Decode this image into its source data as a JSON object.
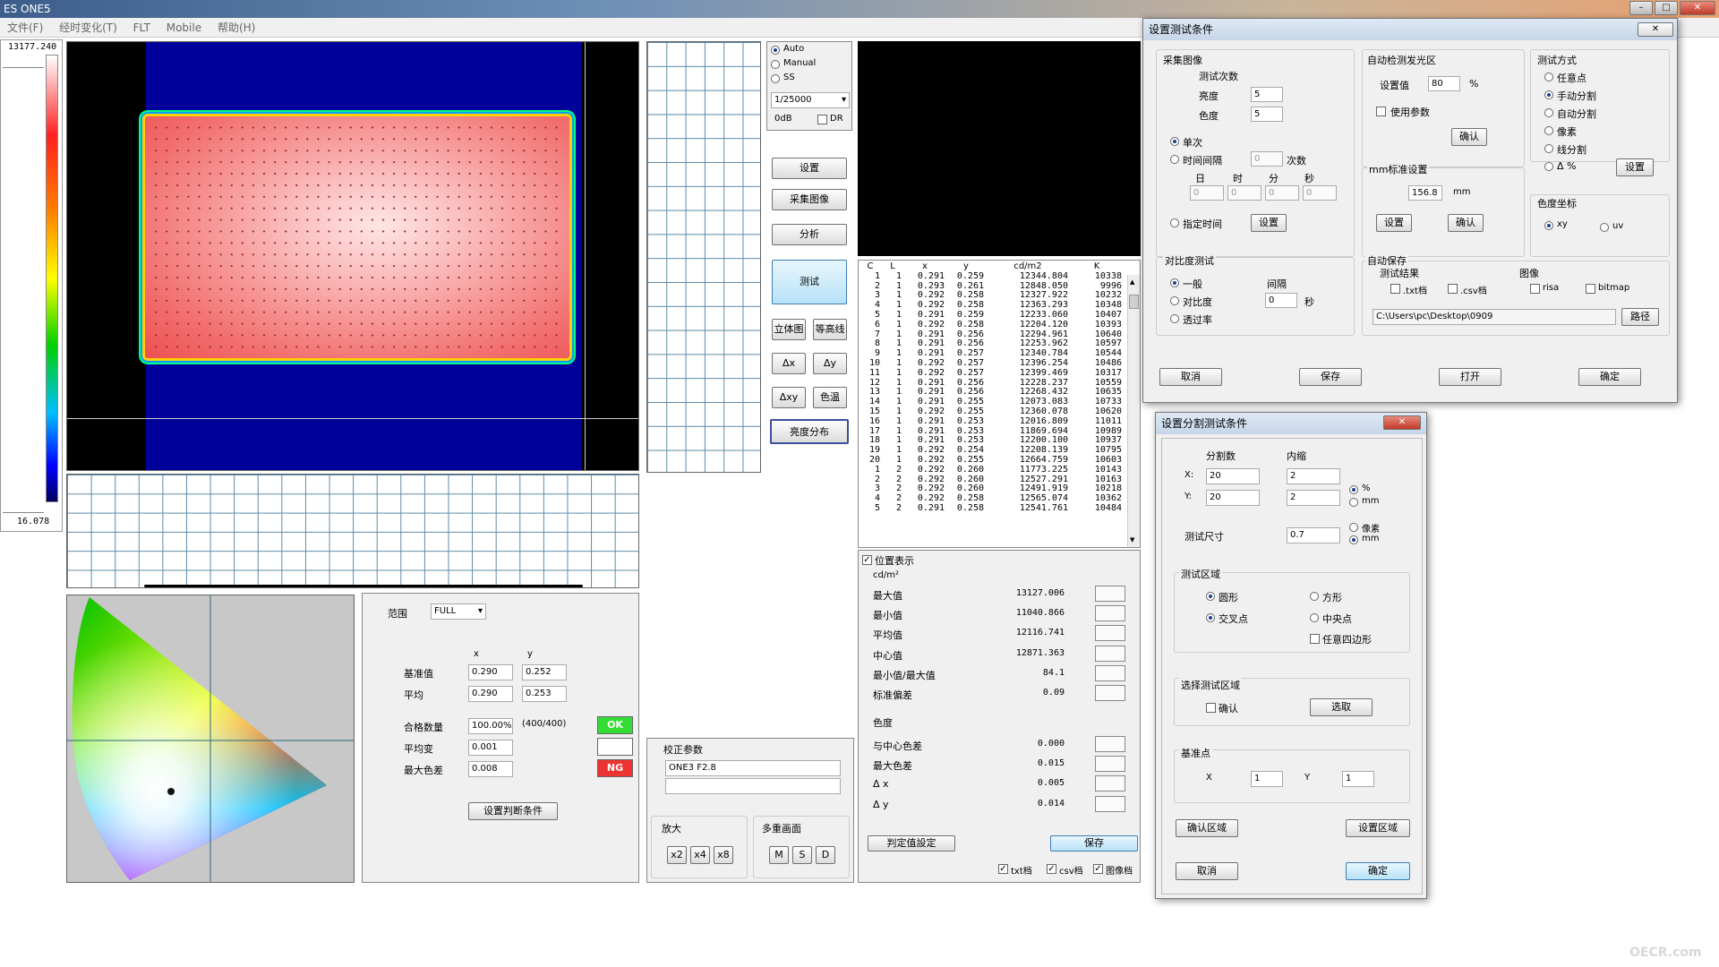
{
  "window": {
    "icon": "ES",
    "title": "ONE5",
    "min_label": "–",
    "max_label": "□",
    "close_label": "✕"
  },
  "menu": [
    "文件(F)",
    "经时变化(T)",
    "FLT",
    "Mobile",
    "帮助(H)"
  ],
  "scale": {
    "max": "13177.240",
    "min": "16.078"
  },
  "camera": {
    "mode_options": [
      "Auto",
      "Manual",
      "SS"
    ],
    "selected_mode": "Auto",
    "shutter": "1/25000",
    "gain": "0dB",
    "dr_label": "DR"
  },
  "side_buttons": {
    "settings": "设置",
    "capture": "采集图像",
    "analyze": "分析",
    "test": "测试",
    "stereo": "立体图",
    "contour": "等高线",
    "dx": "Δx",
    "dy": "Δy",
    "dxy": "Δxy",
    "color_temp": "色温",
    "brightness_dist": "亮度分布"
  },
  "table": {
    "headers": [
      "C",
      "L",
      "x",
      "y",
      "cd/m2",
      "K"
    ],
    "rows": [
      [
        "1",
        "1",
        "0.291",
        "0.259",
        "12344.804",
        "10338"
      ],
      [
        "2",
        "1",
        "0.293",
        "0.261",
        "12848.050",
        "9996"
      ],
      [
        "3",
        "1",
        "0.292",
        "0.258",
        "12327.922",
        "10232"
      ],
      [
        "4",
        "1",
        "0.292",
        "0.258",
        "12363.293",
        "10348"
      ],
      [
        "5",
        "1",
        "0.291",
        "0.259",
        "12233.060",
        "10407"
      ],
      [
        "6",
        "1",
        "0.292",
        "0.258",
        "12204.120",
        "10393"
      ],
      [
        "7",
        "1",
        "0.291",
        "0.256",
        "12294.961",
        "10640"
      ],
      [
        "8",
        "1",
        "0.291",
        "0.256",
        "12253.962",
        "10597"
      ],
      [
        "9",
        "1",
        "0.291",
        "0.257",
        "12340.784",
        "10544"
      ],
      [
        "10",
        "1",
        "0.292",
        "0.257",
        "12396.254",
        "10486"
      ],
      [
        "11",
        "1",
        "0.292",
        "0.257",
        "12399.469",
        "10317"
      ],
      [
        "12",
        "1",
        "0.291",
        "0.256",
        "12228.237",
        "10559"
      ],
      [
        "13",
        "1",
        "0.291",
        "0.256",
        "12268.432",
        "10635"
      ],
      [
        "14",
        "1",
        "0.291",
        "0.255",
        "12073.083",
        "10733"
      ],
      [
        "15",
        "1",
        "0.292",
        "0.255",
        "12360.078",
        "10620"
      ],
      [
        "16",
        "1",
        "0.291",
        "0.253",
        "12016.809",
        "11011"
      ],
      [
        "17",
        "1",
        "0.291",
        "0.253",
        "11869.694",
        "10989"
      ],
      [
        "18",
        "1",
        "0.291",
        "0.253",
        "12200.100",
        "10937"
      ],
      [
        "19",
        "1",
        "0.292",
        "0.254",
        "12208.139",
        "10795"
      ],
      [
        "20",
        "1",
        "0.292",
        "0.255",
        "12664.759",
        "10603"
      ],
      [
        "1",
        "2",
        "0.292",
        "0.260",
        "11773.225",
        "10143"
      ],
      [
        "2",
        "2",
        "0.292",
        "0.260",
        "12527.291",
        "10163"
      ],
      [
        "3",
        "2",
        "0.292",
        "0.260",
        "12491.919",
        "10218"
      ],
      [
        "4",
        "2",
        "0.292",
        "0.258",
        "12565.074",
        "10362"
      ],
      [
        "5",
        "2",
        "0.291",
        "0.258",
        "12541.761",
        "10484"
      ]
    ]
  },
  "position_display": "位置表示",
  "stats": {
    "unit": "cd/m²",
    "rows": [
      {
        "label": "最大值",
        "value": "13127.006"
      },
      {
        "label": "最小值",
        "value": "11040.866"
      },
      {
        "label": "平均值",
        "value": "12116.741"
      },
      {
        "label": "中心值",
        "value": "12871.363"
      },
      {
        "label": "最小值/最大值",
        "value": "84.1"
      },
      {
        "label": "标准偏差",
        "value": "0.09"
      }
    ],
    "chroma_title": "色度",
    "chroma_rows": [
      {
        "label": "与中心色差",
        "value": "0.000"
      },
      {
        "label": "最大色差",
        "value": "0.015"
      },
      {
        "label": "Δ x",
        "value": "0.005"
      },
      {
        "label": "Δ y",
        "value": "0.014"
      }
    ],
    "judge_btn": "判定值設定",
    "save_btn": "保存",
    "txt": "txt档",
    "csv": "csv档",
    "img": "图像档"
  },
  "analysis": {
    "range_label": "范围",
    "range_value": "FULL",
    "col_x": "x",
    "col_y": "y",
    "base_label": "基准值",
    "base_x": "0.290",
    "base_y": "0.252",
    "avg_label": "平均",
    "avg_x": "0.290",
    "avg_y": "0.253",
    "pass_label": "合格数量",
    "pass_value": "100.00%",
    "pass_count": "(400/400)",
    "ok": "OK",
    "avgvar_label": "平均变",
    "avgvar_value": "0.001",
    "maxdiff_label": "最大色差",
    "maxdiff_value": "0.008",
    "ng": "NG",
    "judge_btn": "设置判断条件"
  },
  "calib": {
    "title": "校正参数",
    "value": "ONE3 F2.8",
    "zoom_title": "放大",
    "zoom": [
      "x2",
      "x4",
      "x8"
    ],
    "multi_title": "多重画面",
    "multi": [
      "M",
      "S",
      "D"
    ]
  },
  "dlg1": {
    "title": "设置测试条件",
    "capture_title": "采集图像",
    "count_title": "测试次数",
    "brightness_label": "亮度",
    "brightness_value": "5",
    "chroma_label": "色度",
    "chroma_value": "5",
    "single": "单次",
    "interval": "时间间隔",
    "interval_value": "0",
    "times": "次数",
    "day": "日",
    "hour": "时",
    "minute": "分",
    "second": "秒",
    "d_val": "0",
    "h_val": "0",
    "m_val": "0",
    "s_val": "0",
    "fixed_time": "指定时间",
    "set_btn": "设置",
    "auto_title": "自动检测发光区",
    "setval_label": "设置值",
    "setval_value": "80",
    "percent": "%",
    "use_param": "使用参数",
    "confirm_btn": "确认",
    "mm_title": "mm标准设置",
    "mm_value": "156.8",
    "mm_unit": "mm",
    "mm_set": "设置",
    "mm_confirm": "确认",
    "method_title": "测试方式",
    "methods": [
      "任意点",
      "手动分割",
      "自动分割",
      "像素",
      "线分割",
      "Δ %"
    ],
    "method_selected": "手动分割",
    "method_set": "设置",
    "coord_title": "色度坐标",
    "coord_xy": "xy",
    "coord_uv": "uv",
    "contrast_title": "对比度测试",
    "c_general": "一般",
    "c_ratio": "对比度",
    "c_trans": "透过率",
    "c_interval": "间隔",
    "c_interval_value": "0",
    "c_sec": "秒",
    "autosave_title": "自动保存",
    "result_title": "测试结果",
    "txt": ".txt档",
    "csv": ".csv档",
    "image_title": "图像",
    "risa": "risa",
    "bitmap": "bitmap",
    "path_value": "C:\\Users\\pc\\Desktop\\0909",
    "path_btn": "路径",
    "cancel": "取消",
    "save": "保存",
    "open": "打开",
    "ok": "确定"
  },
  "dlg2": {
    "title": "设置分割测试条件",
    "div_title": "分割数",
    "inner_title": "内缩",
    "x_label": "X:",
    "y_label": "Y:",
    "div_x": "20",
    "div_y": "20",
    "inner_x": "2",
    "inner_y": "2",
    "unit_pct": "%",
    "unit_mm": "mm",
    "size_label": "测试尺寸",
    "size_value": "0.7",
    "unit_px": "像素",
    "unit_mm2": "mm",
    "area_title": "测试区域",
    "circle": "圆形",
    "square": "方形",
    "cross": "交叉点",
    "center": "中央点",
    "quad": "任意四边形",
    "select_title": "选择测试区域",
    "confirm_chk": "确认",
    "select_btn": "选取",
    "ref_title": "基准点",
    "ref_x_label": "X",
    "ref_x": "1",
    "ref_y_label": "Y",
    "ref_y": "1",
    "confirm_area": "确认区域",
    "set_area": "设置区域",
    "cancel": "取消",
    "ok": "确定"
  },
  "watermark": "OECR.com",
  "colors": {
    "accent": "#1b3f8f",
    "ok": "#33dd33",
    "ng": "#ee3333",
    "image_bg": "#000090",
    "panel_red": "#f27070"
  }
}
